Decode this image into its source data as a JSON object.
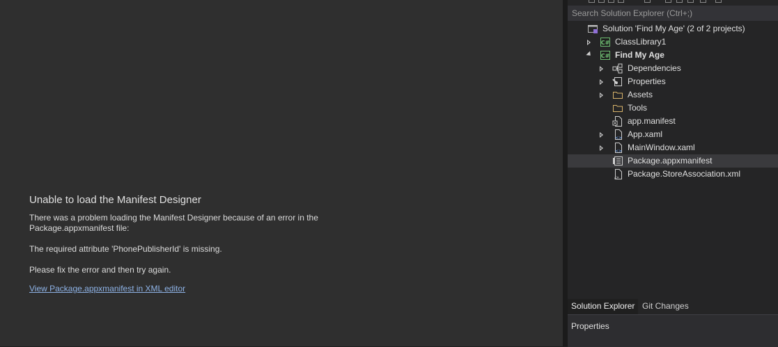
{
  "designer_error": {
    "title": "Unable to load the Manifest Designer",
    "body_line1": "There was a problem loading the Manifest Designer because of an error in the",
    "body_line2": "Package.appxmanifest file:",
    "detail": "The required attribute 'PhonePublisherId' is missing.",
    "instruction": "Please fix the error and then try again.",
    "link": "View Package.appxmanifest in XML editor"
  },
  "solution_explorer": {
    "search_placeholder": "Search Solution Explorer (Ctrl+;)",
    "items": [
      {
        "label": "Solution 'Find My Age' (2 of 2 projects)",
        "icon": "solution-icon",
        "indent": 0,
        "expander": "none"
      },
      {
        "label": "ClassLibrary1",
        "icon": "csharp-project-icon",
        "indent": 1,
        "expander": "collapsed"
      },
      {
        "label": "Find My Age",
        "icon": "csharp-project-icon",
        "indent": 1,
        "expander": "expanded",
        "bold": true
      },
      {
        "label": "Dependencies",
        "icon": "dependencies-icon",
        "indent": 2,
        "expander": "collapsed"
      },
      {
        "label": "Properties",
        "icon": "properties-icon",
        "indent": 2,
        "expander": "collapsed"
      },
      {
        "label": "Assets",
        "icon": "folder-icon",
        "indent": 2,
        "expander": "collapsed"
      },
      {
        "label": "Tools",
        "icon": "folder-icon",
        "indent": 2,
        "expander": "none"
      },
      {
        "label": "app.manifest",
        "icon": "manifest-file-icon",
        "indent": 2,
        "expander": "none"
      },
      {
        "label": "App.xaml",
        "icon": "xaml-file-icon",
        "indent": 2,
        "expander": "collapsed"
      },
      {
        "label": "MainWindow.xaml",
        "icon": "xaml-file-icon",
        "indent": 2,
        "expander": "collapsed"
      },
      {
        "label": "Package.appxmanifest",
        "icon": "appxmanifest-file-icon",
        "indent": 2,
        "expander": "none",
        "selected": true
      },
      {
        "label": "Package.StoreAssociation.xml",
        "icon": "xml-file-icon",
        "indent": 2,
        "expander": "none"
      }
    ],
    "tabs": [
      "Solution Explorer",
      "Git Changes"
    ]
  },
  "properties_panel": {
    "title": "Properties"
  },
  "colors": {
    "doc_background": "#2f2f2f",
    "panel_background": "#252526",
    "link": "#8fb4e8",
    "selection": "#3a3a3d",
    "csharp_icon": "#6fbf73",
    "folder_icon": "#d8b36a"
  }
}
